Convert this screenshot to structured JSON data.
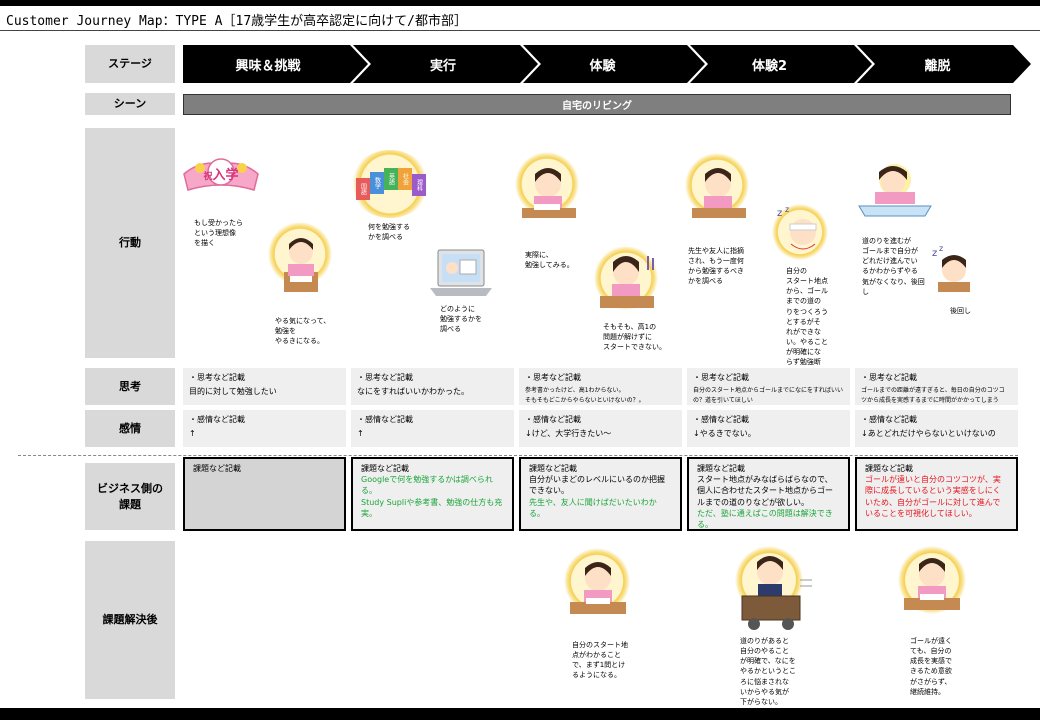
{
  "title": "Customer Journey Map：TYPE A［17歳学生が高卒認定に向けて/都市部］",
  "rows": {
    "stage": "ステージ",
    "scene": "シーン",
    "action": "行動",
    "thought": "思考",
    "emotion": "感情",
    "business": "ビジネス側の\n課題",
    "after": "課題解決後"
  },
  "stages": [
    "興味＆挑戦",
    "実行",
    "体験",
    "体験2",
    "離脱"
  ],
  "scene": "自宅のリビング",
  "illustration_text": {
    "admission_badge": "入学",
    "admission_icon": "祝",
    "subject_books": [
      "国語",
      "数学",
      "英語",
      "社会",
      "理科"
    ]
  },
  "actions": [
    "もし受かったら\nという理想像\nを描く",
    "やる気になって、\n勉強を\nやるきになる。",
    "何を勉強する\nかを調べる",
    "どのように\n勉強するかを\n調べる",
    "実際に、\n勉強してみる。",
    "そもそも、高1の\n問題が解けずに\nスタートできない。",
    "先生や友人に指摘\nされ、もう一度何\nから勉強するべき\nかを調べる",
    "自分の\nスタート地点\nから、ゴール\nまでの道の\nりをつくろう\nとするがそ\nれができな\nい。やること\nが明確にな\nらず勉強断\n念。",
    "道のりを進むが\nゴールまで自分が\nどれだけ進んでい\nるかわからずやる\n気がなくなり、後回\nし",
    "後回し"
  ],
  "thoughts": [
    {
      "h": "・思考など記載",
      "b": "目的に対して勉強したい"
    },
    {
      "h": "・思考など記載",
      "b": "なにをすればいいかわかった。"
    },
    {
      "h": "・思考など記載",
      "b": "参考書かったけど、高1わからない。\nそもそもどこからやらないといけないの？。"
    },
    {
      "h": "・思考など記載",
      "b": "自分のスタート地点からゴールまでになにをすればいい\nの？道を引いてほしい"
    },
    {
      "h": "・思考など記載",
      "b": "ゴールまでの距離が遠すぎると、毎日の自分のコツコ\nツから成長を実感するまでに時間がかかってしまう"
    }
  ],
  "emotions": [
    {
      "h": "・感情など記載",
      "b": "↑"
    },
    {
      "h": "・感情など記載",
      "b": "↑"
    },
    {
      "h": "・感情など記載",
      "b": "↓けど、大学行きたい〜"
    },
    {
      "h": "・感情など記載",
      "b": "↓やるきでない。"
    },
    {
      "h": "・感情など記載",
      "b": "↓あとどれだけやらないといけないの"
    }
  ],
  "business": [
    {
      "h": "課題など記載",
      "k": "",
      "g": "",
      "r": ""
    },
    {
      "h": "課題など記載",
      "k": "",
      "g": "Googleで何を勉強するかは調べられる。\nStudy Supliや参考書、勉強の仕方も充実。",
      "r": ""
    },
    {
      "h": "課題など記載",
      "k": "自分がいまどのレベルにいるのか把握できない。",
      "g": "先生や、友人に聞けばだいたいわかる。",
      "r": ""
    },
    {
      "h": "課題など記載",
      "k": "スタート地点がみなばらばらなので、個人に合わせたスタート地点からゴールまでの道のりなどが欲しい。",
      "g": "ただ、塾に通えばこの問題は解決できる。",
      "r": ""
    },
    {
      "h": "課題など記載",
      "k": "",
      "g": "",
      "r": "ゴールが遠いと自分のコツコツが、実際に成長しているという実感をしにくいため、自分がゴールに対して進んでいることを可視化してほしい。"
    }
  ],
  "after": [
    "自分のスタート地\n点がわかること\nで、まず1問とけ\nるようになる。",
    "道のりがあると\n自分のやること\nが明確で、なにを\nやるかというとこ\nろに悩まされな\nいからやる気が\n下がらない。",
    "ゴールが遠く\nても、自分の\n成長を実感で\nきるため意欲\nがさがらず、\n継続維持。"
  ],
  "colors": {
    "stage_bg": "#000000",
    "scene_bg": "#7f7f7f",
    "label_bg": "#d9d9d9",
    "cell_bg": "#efefef",
    "green": "#1aa53a",
    "red": "#e8141d",
    "halo": "#f6cf4f"
  }
}
